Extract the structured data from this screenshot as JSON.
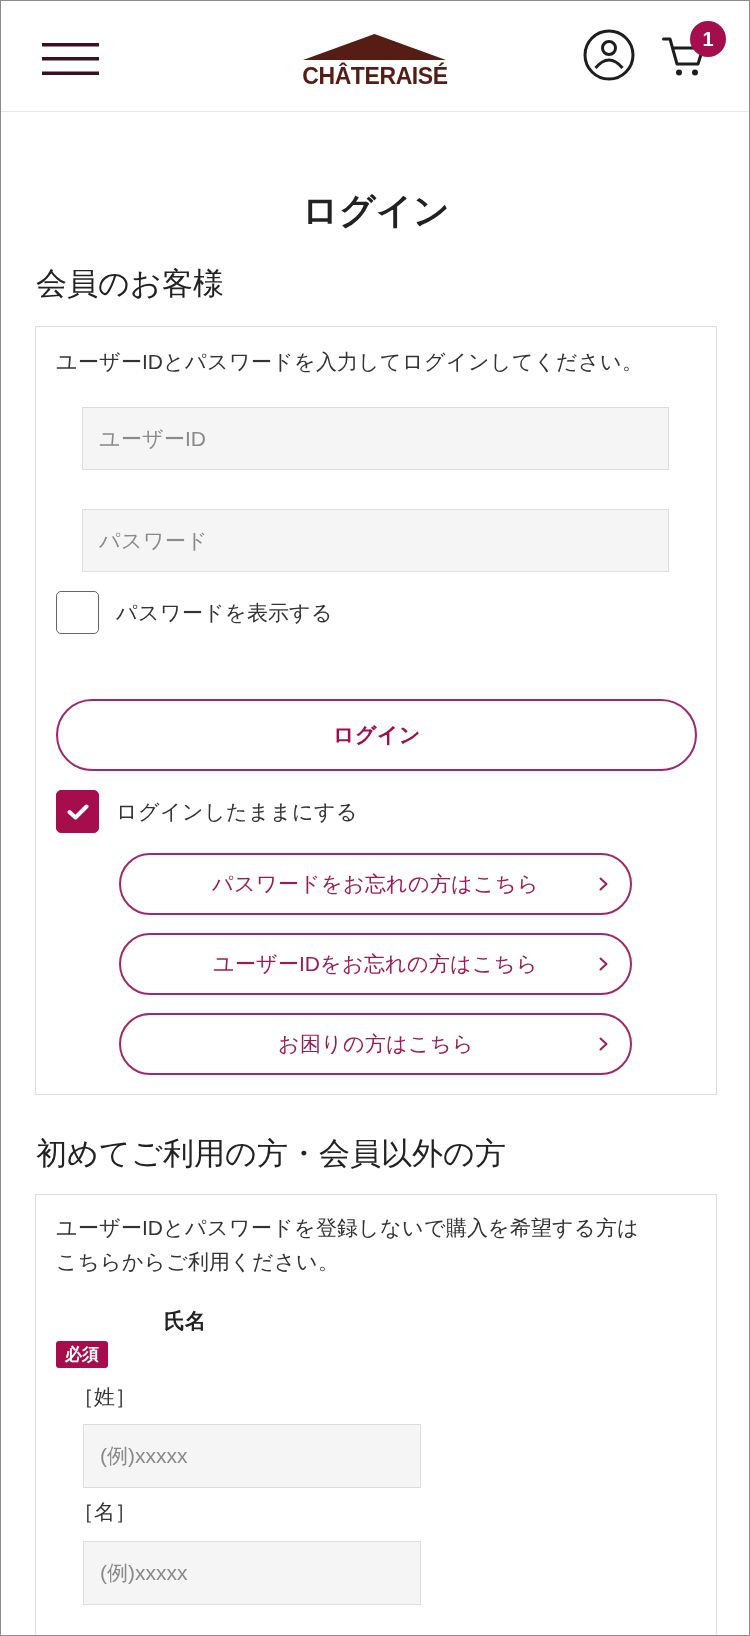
{
  "header": {
    "logo": "CHÂTERAISÉ",
    "cart_count": "1"
  },
  "page_title": "ログイン",
  "member": {
    "heading": "会員のお客様",
    "instruction": "ユーザーIDとパスワードを入力してログインしてください。",
    "fields": [
      {
        "placeholder": "ユーザーID"
      },
      {
        "placeholder": "パスワード"
      }
    ],
    "show_password": {
      "label": "パスワードを表示する",
      "checked": false
    },
    "login_button": "ログイン",
    "stay_logged_in": {
      "label": "ログインしたままにする",
      "checked": true
    },
    "links": [
      "パスワードをお忘れの方はこちら",
      "ユーザーIDをお忘れの方はこちら",
      "お困りの方はこちら"
    ]
  },
  "guest": {
    "heading": "初めてご利用の方・会員以外の方",
    "instruction": "ユーザーIDとパスワードを登録しないで購入を希望する方はこちらからご利用ください。",
    "name_field": {
      "label": "氏名",
      "badge": "必須",
      "parts": [
        {
          "label": "［姓］",
          "placeholder": "(例)xxxxx"
        },
        {
          "label": "［名］",
          "placeholder": "(例)xxxxx"
        }
      ]
    }
  }
}
